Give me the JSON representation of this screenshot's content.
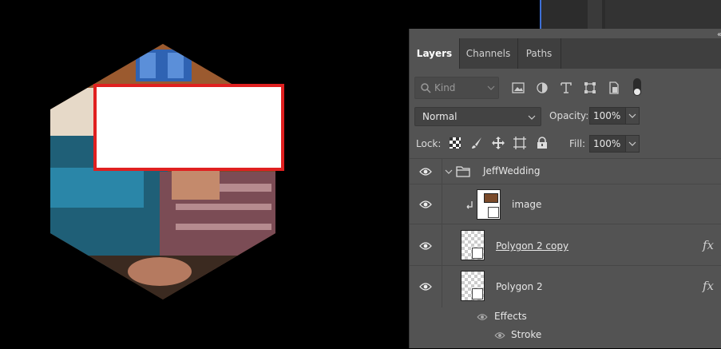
{
  "panel": {
    "tabs": [
      "Layers",
      "Channels",
      "Paths"
    ],
    "filter": {
      "placeholder": "Kind"
    },
    "blend_mode": "Normal",
    "opacity_label": "Opacity:",
    "opacity_value": "100%",
    "lock_label": "Lock:",
    "fill_label": "Fill:",
    "fill_value": "100%"
  },
  "layers": [
    {
      "name": "JeffWedding",
      "type": "group"
    },
    {
      "name": "image",
      "type": "smart-object",
      "clipped": true
    },
    {
      "name": "Polygon 2 copy",
      "type": "smart-object",
      "fx": "fx"
    },
    {
      "name": "Polygon 2",
      "type": "smart-object",
      "fx": "fx",
      "effects_label": "Effects",
      "effects": [
        "Stroke"
      ]
    }
  ]
}
